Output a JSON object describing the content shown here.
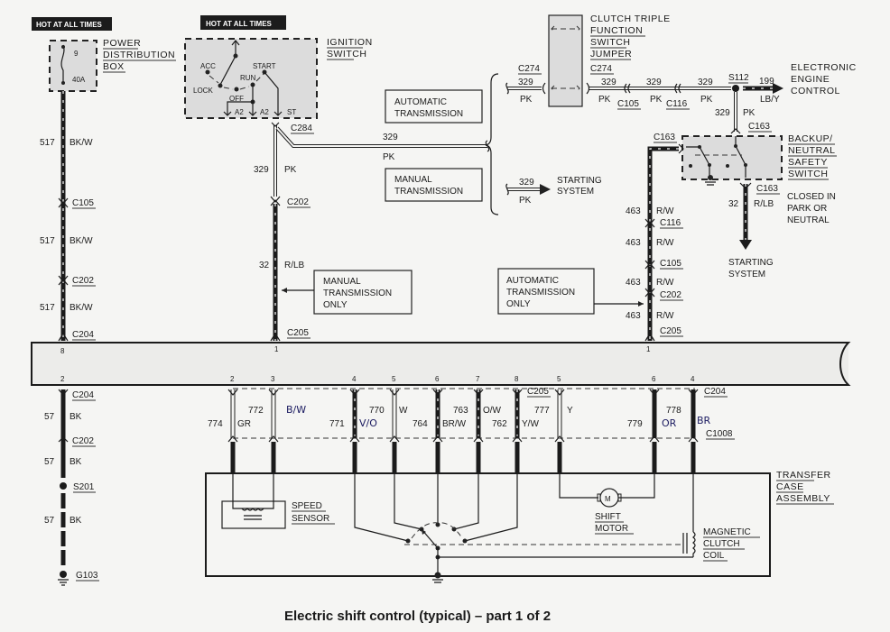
{
  "title": "Electric shift control (typical) – part 1 of 2",
  "hot_labels": {
    "left": "HOT AT ALL TIMES",
    "ignition": "HOT AT ALL TIMES"
  },
  "power_distribution_box": {
    "name": [
      "POWER",
      "DISTRIBUTION",
      "BOX"
    ],
    "fuse_number": "9",
    "fuse_rating": "40A"
  },
  "ignition_switch": {
    "name": [
      "IGNITION",
      "SWITCH"
    ],
    "positions": [
      "ACC",
      "LOCK",
      "OFF",
      "RUN",
      "START"
    ],
    "terminals": [
      "A2",
      "A2",
      "ST"
    ]
  },
  "left_circuit": {
    "segments": [
      {
        "circuit": "517",
        "color": "BK/W"
      },
      {
        "circuit": "517",
        "color": "BK/W"
      },
      {
        "circuit": "517",
        "color": "BK/W"
      }
    ],
    "connectors": [
      "C105",
      "C202",
      "C204"
    ],
    "lower_segments": [
      {
        "circuit": "57",
        "color": "BK"
      },
      {
        "circuit": "57",
        "color": "BK"
      },
      {
        "circuit": "57",
        "color": "BK"
      }
    ],
    "lower_connectors": [
      "C204",
      "C202"
    ],
    "splice": "S201",
    "ground": "G103"
  },
  "ignition_circuit": {
    "connector_top": "C284",
    "wire_h": {
      "circuit": "329",
      "color": "PK"
    },
    "wire_v": {
      "circuit": "329",
      "color": "PK"
    },
    "connector_mid": "C202",
    "wire_low": {
      "circuit": "32",
      "color": "R/LB"
    },
    "connector_bottom": "C205",
    "note": [
      "MANUAL",
      "TRANSMISSION",
      "ONLY"
    ]
  },
  "transmission_options": {
    "automatic": [
      "AUTOMATIC",
      "TRANSMISSION"
    ],
    "manual": [
      "MANUAL",
      "TRANSMISSION"
    ],
    "manual_wire": {
      "circuit": "329",
      "color": "PK"
    },
    "manual_dest": [
      "STARTING",
      "SYSTEM"
    ]
  },
  "clutch_jumper": {
    "name": [
      "CLUTCH TRIPLE",
      "FUNCTION",
      "SWITCH",
      "JUMPER"
    ],
    "connector_left": "C274",
    "connector_right": "C274",
    "wire_left": {
      "circuit": "329",
      "color": "PK"
    },
    "wire_right": {
      "circuit": "329",
      "color": "PK"
    }
  },
  "right_upper": {
    "wire_c105": {
      "circuit": "329",
      "color": "PK",
      "connector": "C105"
    },
    "wire_c116": {
      "circuit": "329",
      "color": "PK",
      "connector": "C116"
    },
    "splice": "S112",
    "eec_wire": {
      "circuit": "199",
      "color": "LB/Y"
    },
    "eec_dest": [
      "ELECTRONIC",
      "ENGINE",
      "CONTROL"
    ],
    "down_wire": {
      "circuit": "329",
      "color": "PK"
    },
    "connector": "C163"
  },
  "safety_switch": {
    "name": [
      "BACKUP/",
      "NEUTRAL",
      "SAFETY",
      "SWITCH"
    ],
    "connector_left": "C163",
    "connector_bottom": "C163",
    "out_wire": {
      "circuit": "32",
      "color": "R/LB"
    },
    "note": [
      "CLOSED IN",
      "PARK OR",
      "NEUTRAL"
    ],
    "dest": [
      "STARTING",
      "SYSTEM"
    ]
  },
  "right_circuit": {
    "segments": [
      {
        "circuit": "463",
        "color": "R/W"
      },
      {
        "circuit": "463",
        "color": "R/W"
      },
      {
        "circuit": "463",
        "color": "R/W"
      },
      {
        "circuit": "463",
        "color": "R/W"
      }
    ],
    "connectors": [
      "C116",
      "C105",
      "C202",
      "C205"
    ],
    "note": [
      "AUTOMATIC",
      "TRANSMISSION",
      "ONLY"
    ]
  },
  "module_bar": {
    "top_pins": [
      "8",
      "1",
      "1"
    ],
    "bottom_pins": [
      "2",
      "2",
      "3",
      "4",
      "5",
      "6",
      "7",
      "8",
      "5",
      "6",
      "4"
    ]
  },
  "harness": {
    "connector_left": "C205",
    "connector_right": "C204",
    "connector_bottom": "C1008",
    "wires": [
      {
        "pin": "2",
        "circuit": "774",
        "color": "GR"
      },
      {
        "pin": "3",
        "circuit": "772",
        "color": "B/W"
      },
      {
        "pin": "4",
        "circuit": "771",
        "color": "V/O"
      },
      {
        "pin": "5",
        "circuit": "770",
        "color": "W"
      },
      {
        "pin": "6",
        "circuit": "764",
        "color": "BR/W"
      },
      {
        "pin": "7",
        "circuit": "763",
        "color": "O/W"
      },
      {
        "pin": "8",
        "circuit": "762",
        "color": "Y/W"
      },
      {
        "pin": "5",
        "circuit": "777",
        "color": "Y"
      },
      {
        "pin": "6",
        "circuit": "779",
        "color": "OR"
      },
      {
        "pin": "4",
        "circuit": "778",
        "color": "BR"
      }
    ]
  },
  "transfer_case": {
    "name": [
      "TRANSFER",
      "CASE",
      "ASSEMBLY"
    ],
    "speed_sensor": [
      "SPEED",
      "SENSOR"
    ],
    "shift_motor": [
      "SHIFT",
      "MOTOR"
    ],
    "motor_symbol": "M",
    "clutch_coil": [
      "MAGNETIC",
      "CLUTCH",
      "COIL"
    ]
  }
}
